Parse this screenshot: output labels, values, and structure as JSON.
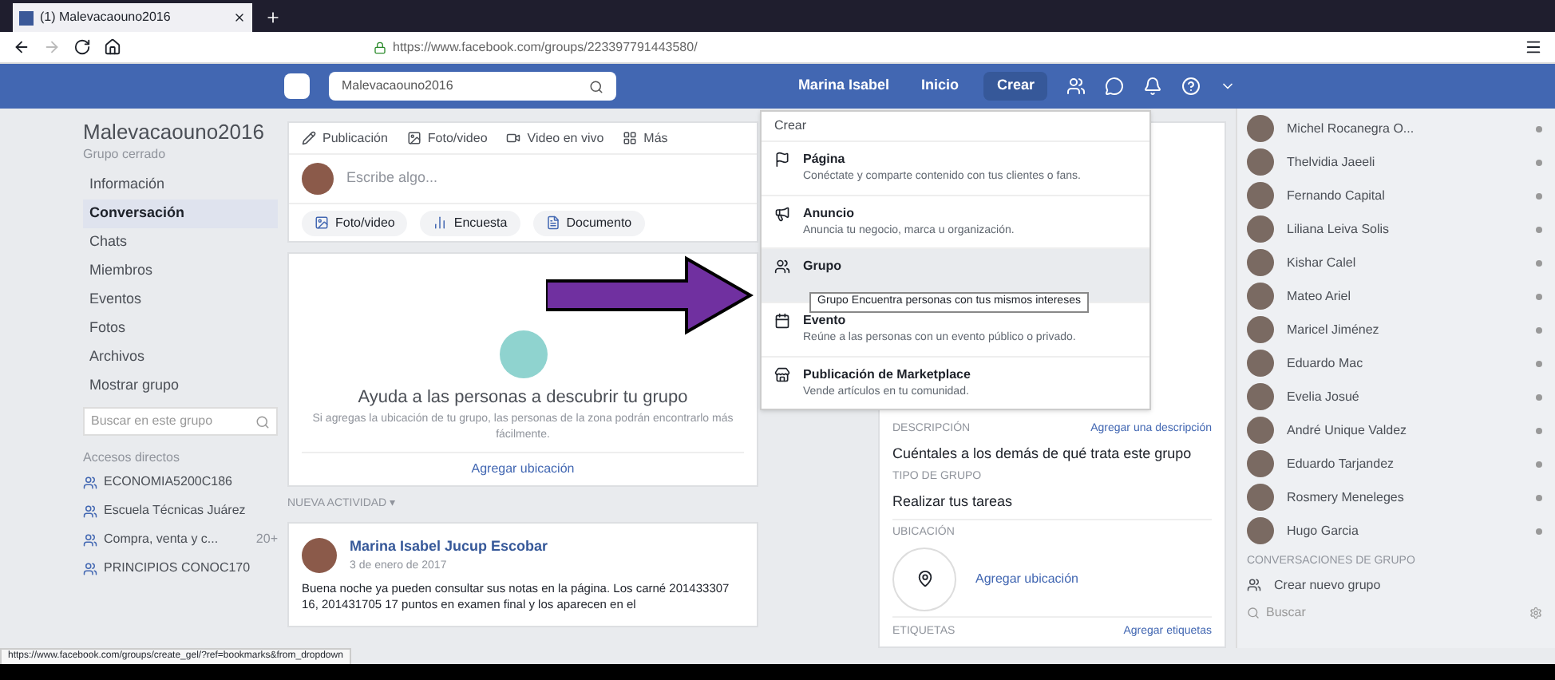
{
  "browser": {
    "tab_title": "(1) Malevacaouno2016",
    "url": "https://www.facebook.com/groups/223397791443580/"
  },
  "topbar": {
    "search_value": "Malevacaouno2016",
    "nav": [
      {
        "label": "Marina Isabel",
        "selected": false
      },
      {
        "label": "Inicio",
        "selected": false
      },
      {
        "label": "Crear",
        "selected": true
      }
    ]
  },
  "group": {
    "name": "Malevacaouno2016",
    "privacy": "Grupo cerrado",
    "menu": [
      {
        "label": "Información",
        "selected": false
      },
      {
        "label": "Conversación",
        "selected": true
      },
      {
        "label": "Chats",
        "selected": false
      },
      {
        "label": "Miembros",
        "selected": false
      },
      {
        "label": "Eventos",
        "selected": false
      },
      {
        "label": "Fotos",
        "selected": false
      },
      {
        "label": "Archivos",
        "selected": false
      },
      {
        "label": "Mostrar grupo",
        "selected": false
      }
    ],
    "search_placeholder": "Buscar en este grupo",
    "shortcuts_title": "Accesos directos",
    "shortcuts": [
      {
        "label": "ECONOMIA5200C186"
      },
      {
        "label": "Escuela Técnicas Juárez"
      },
      {
        "label": "Compra, venta y c...",
        "count": "20+"
      },
      {
        "label": "PRINCIPIOS CONOC170"
      }
    ]
  },
  "composer": {
    "tabs": [
      "Publicación",
      "Foto/video",
      "Video en vivo",
      "Más"
    ],
    "placeholder": "Escribe algo...",
    "actions": [
      "Foto/video",
      "Encuesta",
      "Documento"
    ]
  },
  "discover": {
    "title": "Ayuda a las personas a descubrir tu grupo",
    "text": "Si agregas la ubicación de tu grupo, las personas de la zona podrán encontrarlo más fácilmente.",
    "link": "Agregar ubicación"
  },
  "activity_label": "NUEVA ACTIVIDAD ▾",
  "post": {
    "author": "Marina Isabel Jucup Escobar",
    "date": "3 de enero de 2017",
    "text": "Buena noche ya pueden consultar sus notas en la página. Los carné 201433307 16, 201431705 17 puntos en examen final y los aparecen en el"
  },
  "about": {
    "description_label": "DESCRIPCIÓN",
    "description_link": "Agregar una descripción",
    "description": "Cuéntales a los demás de qué trata este grupo",
    "type_label": "TIPO DE GRUPO",
    "type": "Realizar tus tareas",
    "location_label": "UBICACIÓN",
    "location_link": "Agregar ubicación",
    "tags_label": "ETIQUETAS",
    "tags_link": "Agregar etiquetas"
  },
  "create_menu": {
    "title": "Crear",
    "items": [
      {
        "kind": "page",
        "label": "Página",
        "description": "Conéctate y comparte contenido con tus clientes o fans.",
        "selected": false
      },
      {
        "kind": "ad",
        "label": "Anuncio",
        "description": "Anuncia tu negocio, marca u organización.",
        "selected": false
      },
      {
        "kind": "group",
        "label": "Grupo",
        "selected": true
      },
      {
        "kind": "event",
        "label": "Evento",
        "description": "Reúne a las personas con un evento público o privado.",
        "selected": false
      },
      {
        "kind": "marketplace",
        "label": "Publicación de Marketplace",
        "description": "Vende artículos en tu comunidad.",
        "selected": false
      }
    ],
    "tooltip": "Grupo Encuentra personas con tus mismos intereses"
  },
  "chat": {
    "contacts": [
      "Michel Rocanegra O...",
      "Thelvidia Jaeeli",
      "Fernando Capital",
      "Liliana Leiva Solis",
      "Kishar Calel",
      "Mateo Ariel",
      "Maricel Jiménez",
      "Eduardo Mac",
      "Evelia Josué",
      "André Unique Valdez",
      "Eduardo Tarjandez",
      "Rosmery Meneleges",
      "Hugo Garcia"
    ],
    "group_heading": "CONVERSACIONES DE GRUPO",
    "create_group": "Crear nuevo grupo",
    "search_placeholder": "Buscar"
  },
  "status_url": "https://www.facebook.com/groups/create_gel/?ref=bookmarks&from_dropdown"
}
